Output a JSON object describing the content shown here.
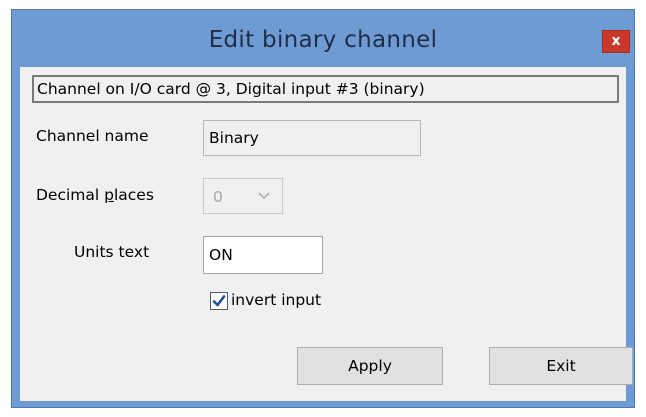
{
  "dialog": {
    "title": "Edit binary channel",
    "close_label": "x"
  },
  "info": {
    "text": "Channel on I/O card @ 3, Digital input #3 (binary)"
  },
  "fields": {
    "channel_name_label": "Channel name",
    "channel_name_value": "Binary",
    "decimal_places_label_pre": "Decimal ",
    "decimal_places_label_accel": "p",
    "decimal_places_label_post": "laces",
    "decimal_places_value": "0",
    "units_text_label": "Units text",
    "units_text_value": "ON"
  },
  "options": {
    "invert_input_label": "invert input",
    "invert_input_checked": true
  },
  "buttons": {
    "apply_label": "Apply",
    "exit_label": "Exit"
  },
  "colors": {
    "frame": "#6f9bd4",
    "close_button": "#c9392b",
    "client_background": "#f0f0f0",
    "checkmark": "#1a4fa0"
  },
  "icons": {
    "close": "close-icon",
    "dropdown": "chevron-down-icon",
    "check": "checkmark-icon"
  }
}
